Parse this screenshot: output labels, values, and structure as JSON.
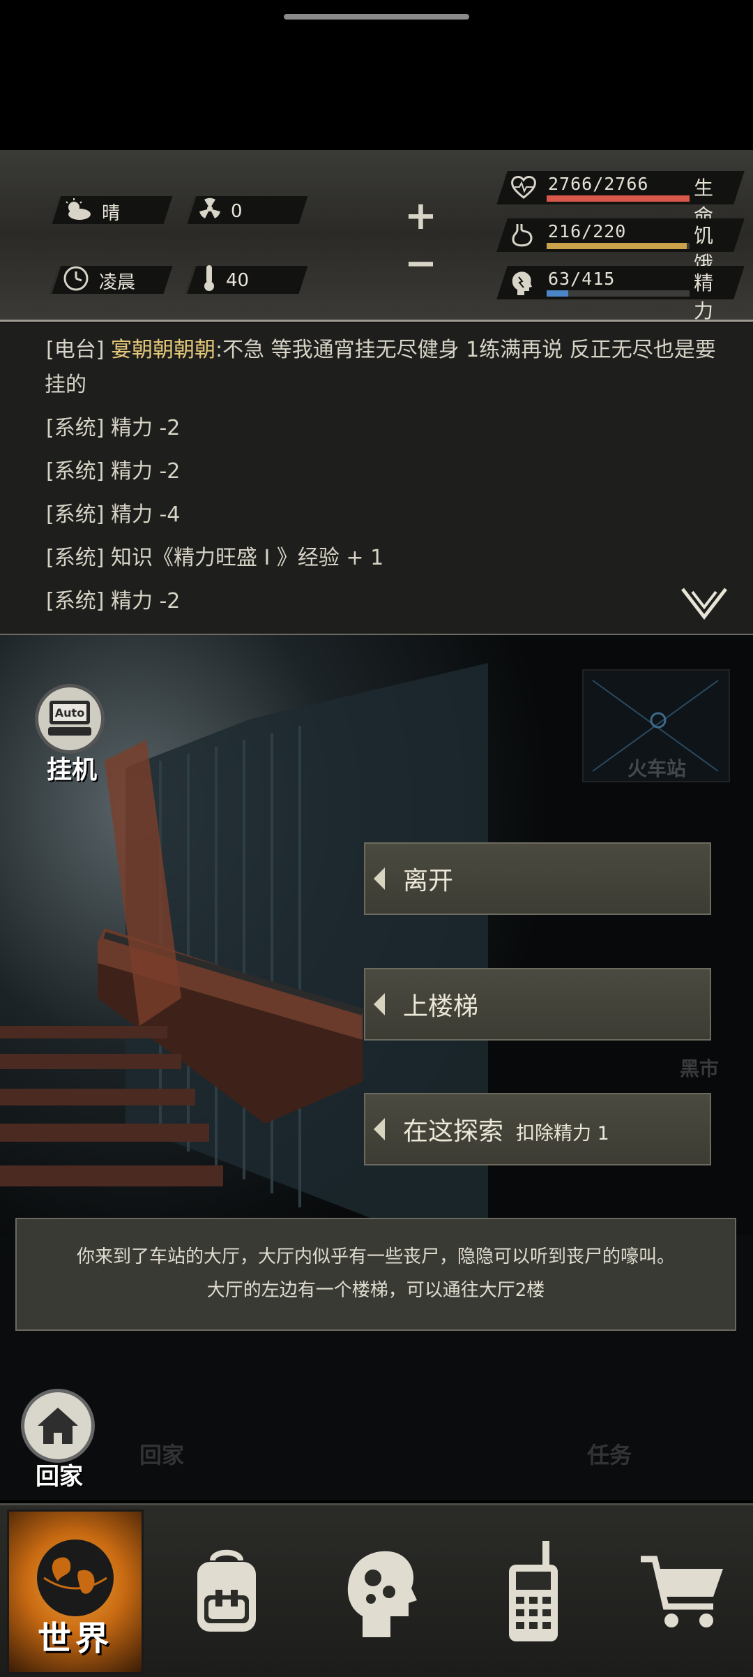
{
  "status": {
    "weather": "晴",
    "radiation": "0",
    "time_of_day": "凌晨",
    "temperature": "40"
  },
  "vitals": [
    {
      "key": "life",
      "value": "2766/2766",
      "label": "生命",
      "fraction": 1.0,
      "color": "#d9584a"
    },
    {
      "key": "hunger",
      "value": "216/220",
      "label": "饥饿",
      "fraction": 0.98,
      "color": "#c9a24a"
    },
    {
      "key": "energy",
      "value": "63/415",
      "label": "精力",
      "fraction": 0.152,
      "color": "#4a86c8"
    }
  ],
  "log": {
    "radio_tag": "[电台]",
    "radio_name": "宴朝朝朝朝",
    "radio_text_1": ":不急 等我通宵挂无尽健身 1练满再说 反正无尽也是要",
    "radio_text_2": "挂的",
    "lines": [
      "[系统] 精力 -2",
      "[系统] 精力 -2",
      "[系统] 精力 -4",
      "[系统] 知识《精力旺盛 I 》经验 + 1",
      "[系统] 精力 -2"
    ]
  },
  "scene": {
    "auto_label": "挂机",
    "auto_icon_text": "Auto",
    "location": "火车站",
    "ghost_black_market": "黑市",
    "ghost_home": "回家",
    "ghost_task": "任务",
    "actions": [
      {
        "label": "离开",
        "sub": ""
      },
      {
        "label": "上楼梯",
        "sub": ""
      },
      {
        "label": "在这探索",
        "sub": "扣除精力 1"
      }
    ],
    "description_1": "你来到了车站的大厅，大厅内似乎有一些丧尸，隐隐可以听到丧尸的嚎叫。",
    "description_2": "大厅的左边有一个楼梯，可以通往大厅2楼",
    "home_label": "回家"
  },
  "nav": {
    "world_label": "世界",
    "tabs": [
      "world-icon",
      "backpack-icon",
      "skills-head-icon",
      "radio-phone-icon",
      "shop-cart-icon"
    ]
  }
}
